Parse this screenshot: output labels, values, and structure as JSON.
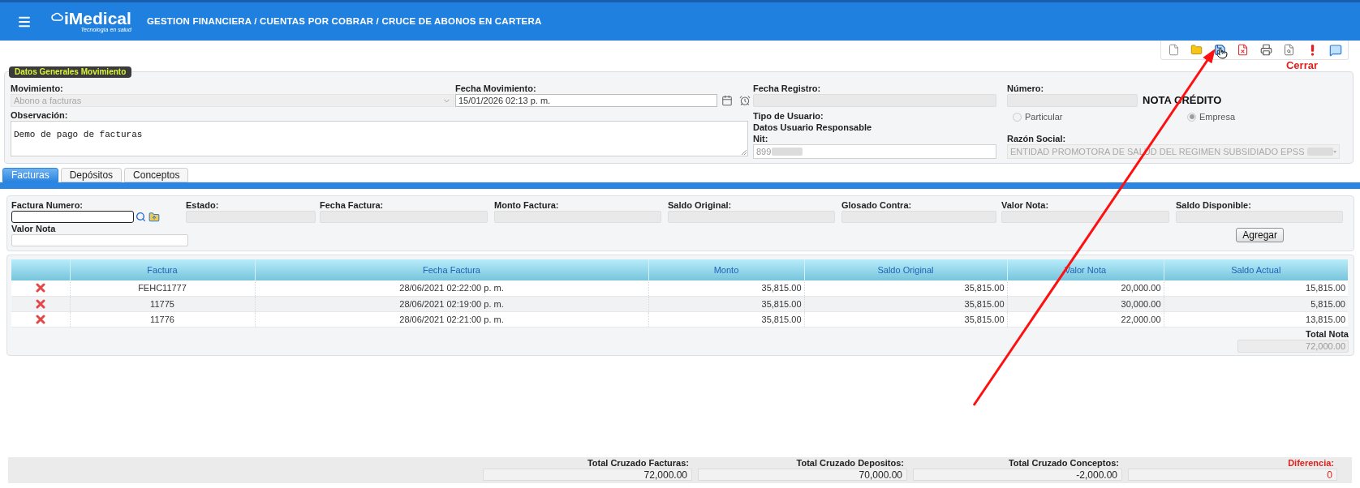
{
  "header": {
    "app_name": "iMedical",
    "tagline": "Tecnología en salud",
    "breadcrumb": "GESTION FINANCIERA / CUENTAS POR COBRAR / CRUCE DE ABONOS EN CARTERA"
  },
  "toolbar": {
    "buttons": [
      {
        "kind": "new"
      },
      {
        "kind": "open"
      },
      {
        "kind": "save"
      },
      {
        "kind": "delete"
      },
      {
        "kind": "print"
      },
      {
        "kind": "preview"
      },
      {
        "kind": "alert"
      },
      {
        "kind": "comment"
      }
    ],
    "close_label": "Cerrar"
  },
  "general": {
    "legend": "Datos Generales Movimiento",
    "movimiento": {
      "label": "Movimiento:",
      "value": "Abono a facturas",
      "disabled": true
    },
    "fecha_movimiento": {
      "label": "Fecha Movimiento:",
      "value": "15/01/2026 02:13 p. m."
    },
    "fecha_registro": {
      "label": "Fecha Registro:"
    },
    "numero": {
      "label": "Número:"
    },
    "document_type": "NOTA CRÉDITO",
    "observacion": {
      "label": "Observación:",
      "value": "Demo de pago de facturas"
    },
    "tipo_usuario": {
      "label": "Tipo de Usuario:",
      "disabled": true,
      "options": [
        {
          "label": "Particular",
          "selected": false
        },
        {
          "label": "Empresa",
          "selected": true
        }
      ]
    },
    "responsable_heading": "Datos Usuario Responsable",
    "nit": {
      "label": "Nit:",
      "value": "899",
      "redacted": true
    },
    "razon_social": {
      "label": "Razón Social:",
      "value": "ENTIDAD PROMOTORA DE SALUD DEL REGIMEN SUBSIDIADO EPSS",
      "redacted": true,
      "disabled": true
    }
  },
  "tabs": [
    {
      "label": "Facturas",
      "selected": true
    },
    {
      "label": "Depósitos",
      "selected": false
    },
    {
      "label": "Conceptos",
      "selected": false
    }
  ],
  "invoice_form": {
    "factura_numero": {
      "label": "Factura Numero:"
    },
    "fields": [
      {
        "label": "Estado:"
      },
      {
        "label": "Fecha Factura:"
      },
      {
        "label": "Monto Factura:"
      },
      {
        "label": "Saldo Original:"
      },
      {
        "label": "Glosado Contra:"
      },
      {
        "label": "Valor Nota:"
      },
      {
        "label": "Saldo Disponible:"
      }
    ],
    "valor_nota": {
      "label": "Valor Nota"
    },
    "add_button": "Agregar"
  },
  "table": {
    "columns": [
      "Factura",
      "Fecha Factura",
      "Monto",
      "Saldo Original",
      "Valor Nota",
      "Saldo Actual"
    ],
    "rows": [
      {
        "cells": [
          "FEHC11777",
          "28/06/2021 02:22:00 p. m.",
          "35,815.00",
          "35,815.00",
          "20,000.00",
          "15,815.00"
        ]
      },
      {
        "cells": [
          "11775",
          "28/06/2021 02:19:00 p. m.",
          "35,815.00",
          "35,815.00",
          "30,000.00",
          "5,815.00"
        ]
      },
      {
        "cells": [
          "11776",
          "28/06/2021 02:21:00 p. m.",
          "35,815.00",
          "35,815.00",
          "22,000.00",
          "13,815.00"
        ]
      }
    ],
    "total_label": "Total Nota",
    "total_value": "72,000.00"
  },
  "totals": [
    {
      "label": "Total Cruzado Facturas:",
      "value": "72,000.00",
      "kind": "amount"
    },
    {
      "label": "Total Cruzado Depositos:",
      "value": "70,000.00",
      "kind": "amount"
    },
    {
      "label": "Total Cruzado Conceptos:",
      "value": "-2,000.00",
      "kind": "amount"
    },
    {
      "label": "Diferencia:",
      "value": "0",
      "kind": "difference"
    }
  ]
}
